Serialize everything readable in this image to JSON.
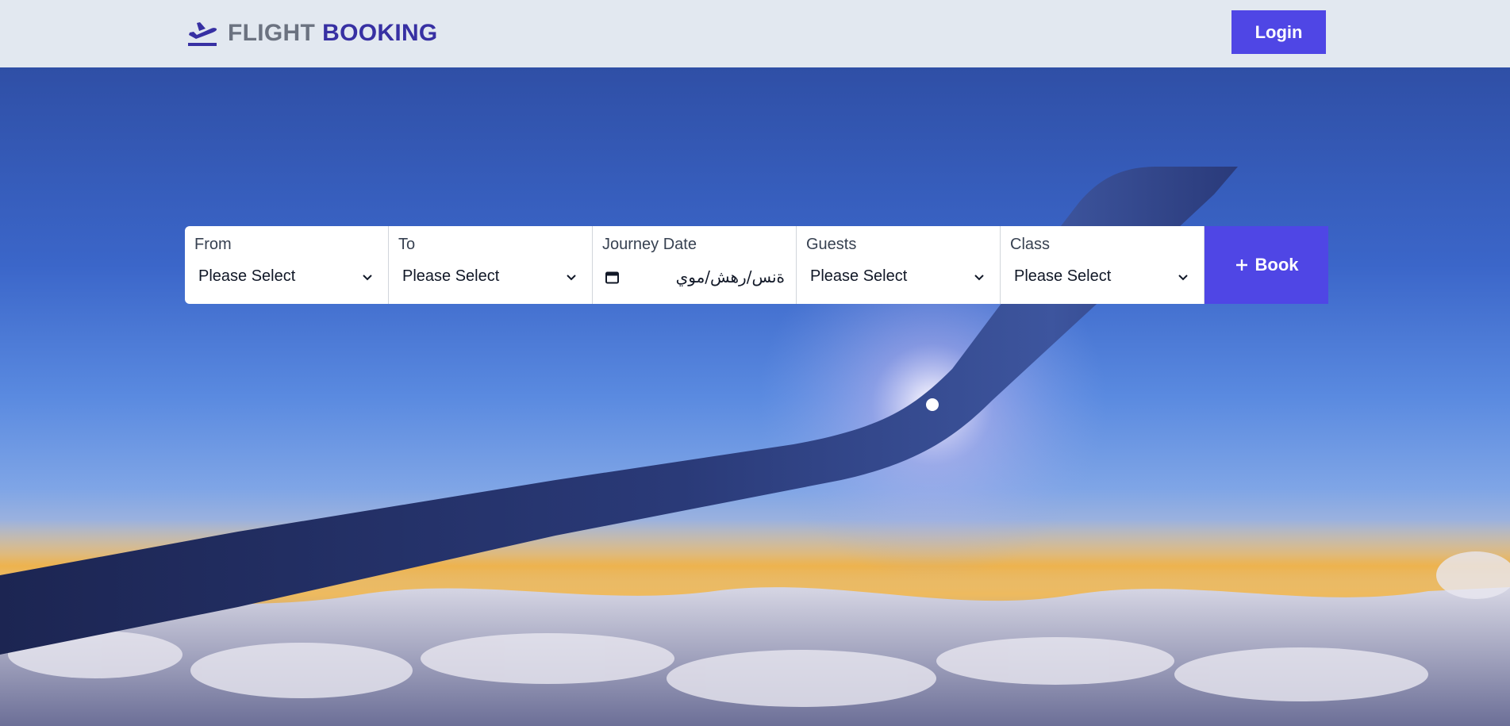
{
  "brand": {
    "word1": "FLIGHT",
    "word2": "BOOKING",
    "icon": "plane-takeoff-icon"
  },
  "header": {
    "login_label": "Login"
  },
  "search": {
    "from": {
      "label": "From",
      "value": "Please Select"
    },
    "to": {
      "label": "To",
      "value": "Please Select"
    },
    "date": {
      "label": "Journey Date",
      "value": "ةنس/رهش/موي"
    },
    "guests": {
      "label": "Guests",
      "value": "Please Select"
    },
    "class": {
      "label": "Class",
      "value": "Please Select"
    },
    "book_label": "Book"
  },
  "colors": {
    "accent": "#4f46e5",
    "brand_dark": "#3730a3",
    "header_bg": "#e2e8f0"
  }
}
